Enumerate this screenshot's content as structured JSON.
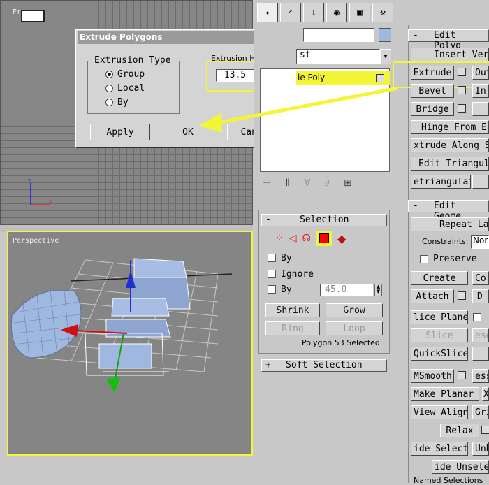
{
  "viewports": {
    "perspective_label": "Perspective",
    "top_left_label": "Fr"
  },
  "dialog": {
    "title": "Extrude Polygons",
    "close_glyph": "×",
    "group_title": "Extrusion Type",
    "options": [
      "Group",
      "Local",
      "By"
    ],
    "selected_option": "Group",
    "height_label": "Extrusion Height:",
    "height_value": "-13.5",
    "apply_label": "Apply",
    "ok_label": "OK",
    "cancel_label": "Cancel"
  },
  "modifier_stack": {
    "dropdown_text": "st",
    "item_label": "le Poly"
  },
  "selection_rollout": {
    "title": "Selection",
    "collapse_glyph": "-",
    "checkbox_by": "By",
    "checkbox_ignore": "Ignore",
    "checkbox_by2": "By",
    "angle_value": "45.0",
    "shrink_label": "Shrink",
    "grow_label": "Grow",
    "ring_label": "Ring",
    "loop_label": "Loop",
    "status": "Polygon 53 Selected"
  },
  "soft_selection": {
    "title": "Soft Selection",
    "expand_glyph": "+"
  },
  "edit_polygons": {
    "title": "Edit Polyg",
    "collapse_glyph": "-",
    "insert_vertex": "Insert Ver",
    "extrude": "Extrude",
    "outline": "Out",
    "bevel": "Bevel",
    "inset": "In",
    "bridge": "Bridge",
    "hinge": "Hinge From E",
    "extrude_along": "xtrude Along S",
    "edit_triangulation": "Edit Triangul",
    "retriangulate": "etriangulat"
  },
  "edit_geometry": {
    "title": "Edit Geome",
    "collapse_glyph": "-",
    "repeat_last": "Repeat La",
    "constraints_label": "Constraints:",
    "constraints_value": "Non",
    "preserve": "Preserve",
    "create": "Create",
    "collapse": "Co",
    "attach": "Attach",
    "detach": "D",
    "slice_plane": "lice Plane",
    "slice": "Slice",
    "reset": "ese",
    "quickslice": "QuickSlice",
    "msmooth": "MSmooth",
    "tessellate": "ess",
    "make_planar": "Make Planar",
    "x": "X",
    "view_align": "View Align",
    "grid_align": "Gri",
    "relax": "Relax",
    "hide_selected": "ide Selecte",
    "unhide": "Unh",
    "hide_unselected": "ide Unsele",
    "named_selections": "Named Selections"
  },
  "colors": {
    "highlight": "#f5f537",
    "selected_poly": "#ff0000",
    "mesh": "#9fb8e0"
  }
}
